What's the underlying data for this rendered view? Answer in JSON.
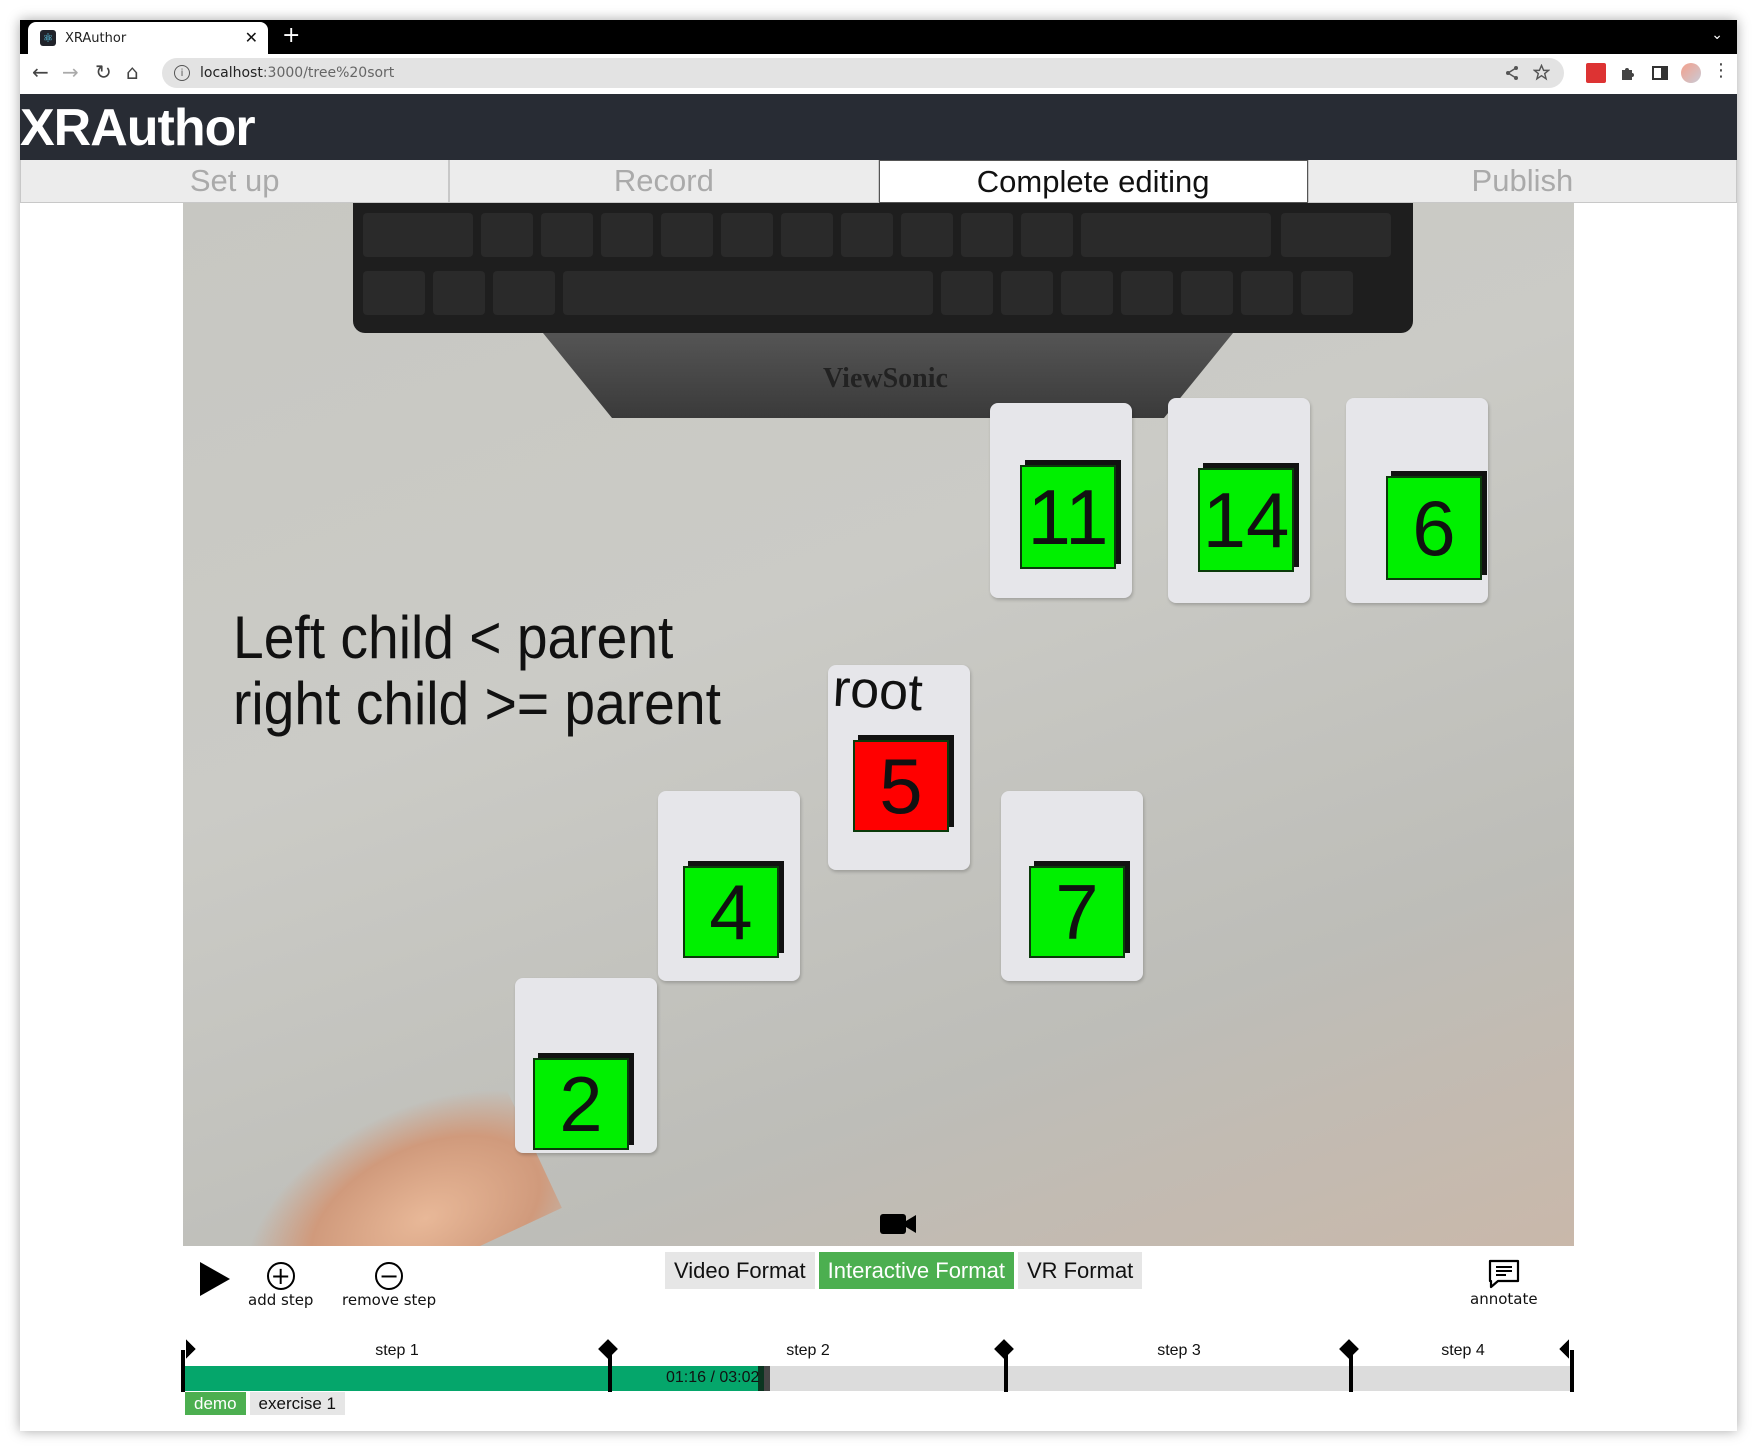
{
  "browser": {
    "tab_title": "XRAuthor",
    "tab_close": "✕",
    "new_tab": "+",
    "tab_menu": "⌄",
    "url_host": "localhost",
    "url_path": ":3000/tree%20sort",
    "nav": {
      "back": "←",
      "forward": "→",
      "reload": "↻",
      "home": "⌂"
    },
    "icons": {
      "share": "share-icon",
      "bookmark": "star-icon",
      "extension": "puzzle-icon",
      "sidepanel": "side-panel-icon",
      "profile": "avatar",
      "menu": "⋮"
    }
  },
  "app": {
    "title": "XRAuthor",
    "steps": [
      {
        "label": "Set up",
        "active": false
      },
      {
        "label": "Record",
        "active": false
      },
      {
        "label": "Complete editing",
        "active": true
      },
      {
        "label": "Publish",
        "active": false
      }
    ]
  },
  "video": {
    "overlay_line1": "Left child < parent",
    "overlay_line2": "right child >= parent",
    "root_label": "root",
    "monitor_brand": "ViewSonic",
    "blocks": [
      {
        "value": "11",
        "color": "#00f000"
      },
      {
        "value": "14",
        "color": "#00f000"
      },
      {
        "value": "6",
        "color": "#00f000"
      },
      {
        "value": "5",
        "color": "#ff0000"
      },
      {
        "value": "4",
        "color": "#00f000"
      },
      {
        "value": "7",
        "color": "#00f000"
      },
      {
        "value": "2",
        "color": "#00f000"
      }
    ]
  },
  "controls": {
    "play": "play-icon",
    "add_step": "add step",
    "remove_step": "remove step",
    "formats": [
      {
        "label": "Video Format",
        "active": false
      },
      {
        "label": "Interactive Format",
        "active": true
      },
      {
        "label": "VR Format",
        "active": false
      }
    ],
    "annotate": "annotate",
    "accent": "#4caf50"
  },
  "timeline": {
    "current": "01:16",
    "total": "03:02",
    "timecode": "01:16 / 03:02",
    "progress": 0.418,
    "fill_color": "#05a66b",
    "steps": [
      {
        "label": "step 1",
        "start": 0.0,
        "end": 0.307
      },
      {
        "label": "step 2",
        "start": 0.307,
        "end": 0.592
      },
      {
        "label": "step 3",
        "start": 0.592,
        "end": 0.84
      },
      {
        "label": "step 4",
        "start": 0.84,
        "end": 1.0
      }
    ]
  },
  "modes": [
    {
      "label": "demo",
      "active": true
    },
    {
      "label": "exercise 1",
      "active": false
    }
  ]
}
